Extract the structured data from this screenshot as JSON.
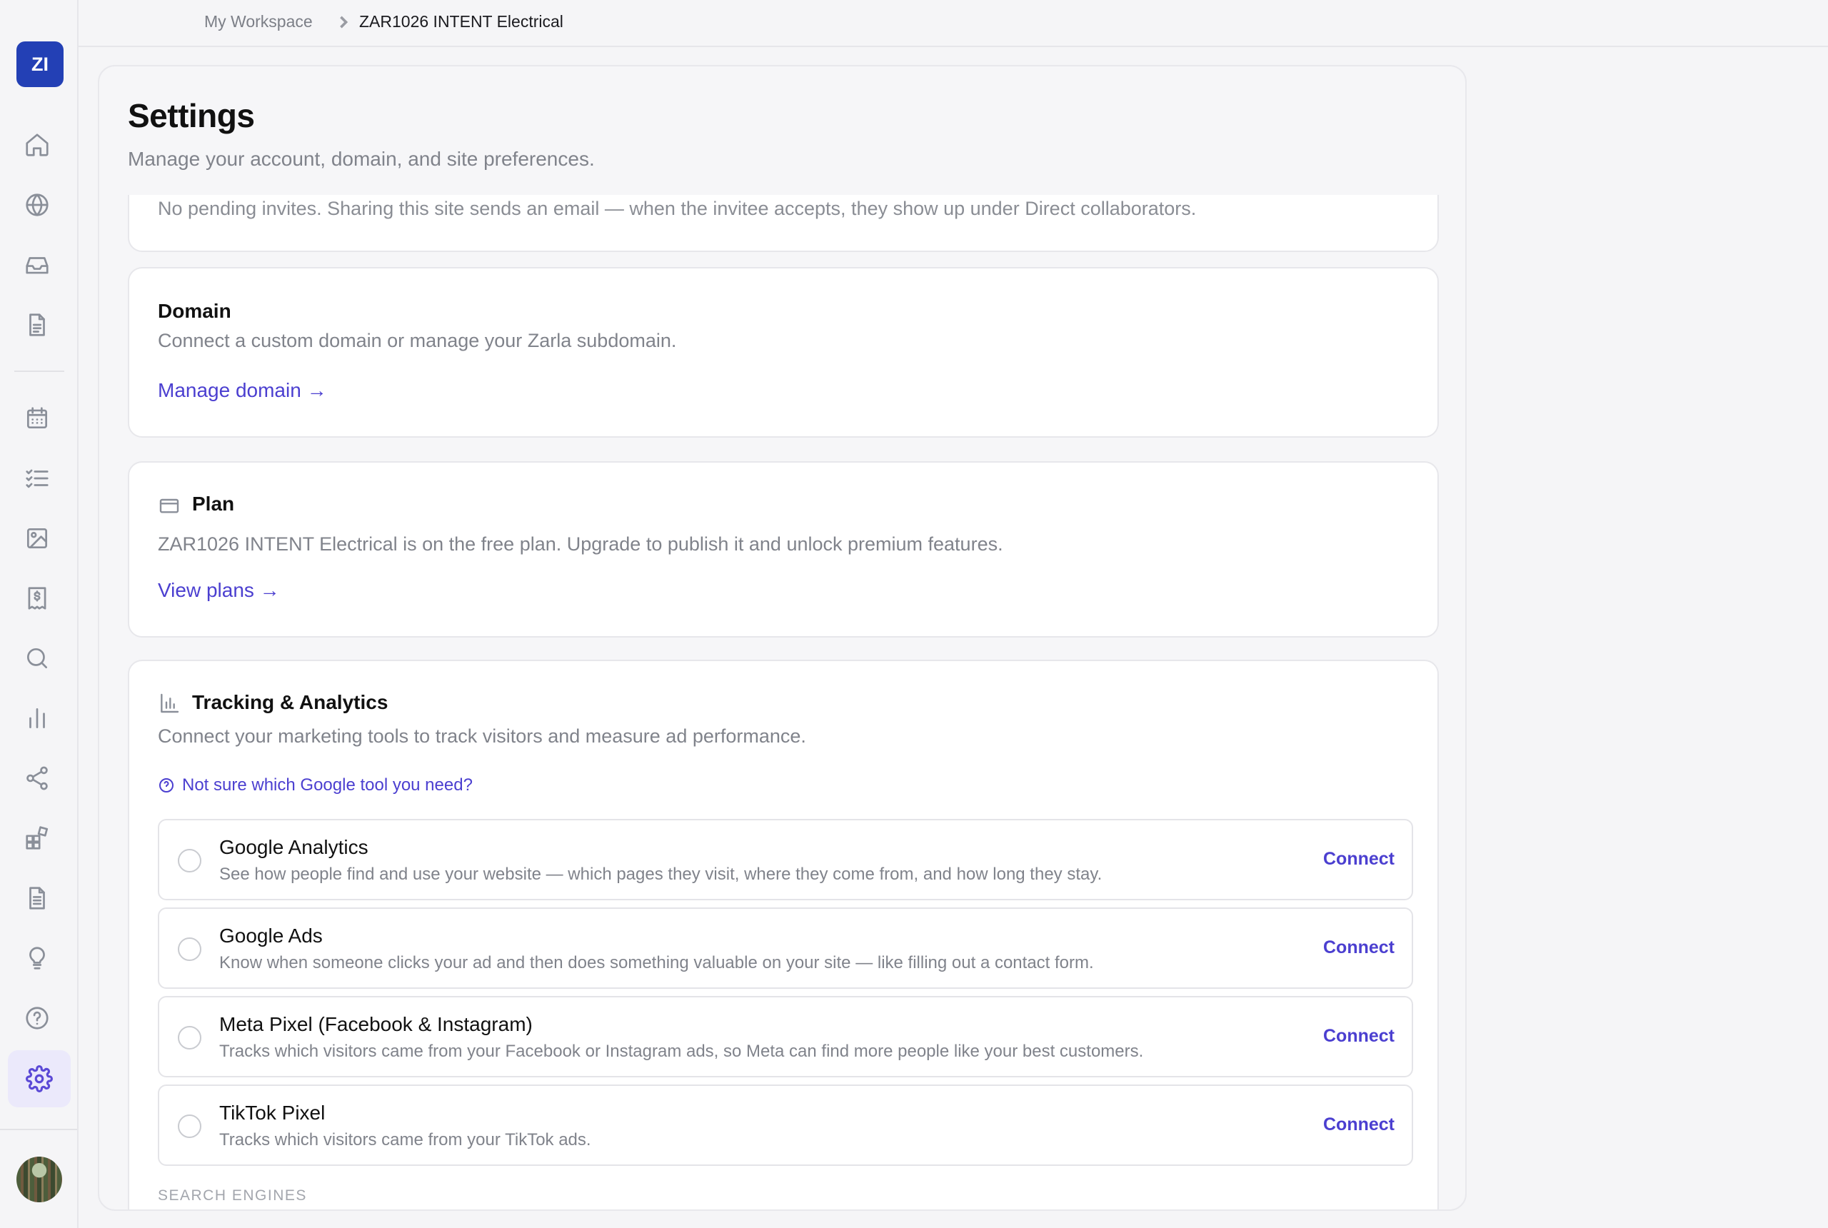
{
  "sidebar": {
    "logo_text": "ZI",
    "items": [
      {
        "name": "home-icon"
      },
      {
        "name": "globe-icon"
      },
      {
        "name": "inbox-icon"
      },
      {
        "name": "document-icon"
      },
      {
        "name": "calendar-icon"
      },
      {
        "name": "checklist-icon"
      },
      {
        "name": "image-icon"
      },
      {
        "name": "invoice-icon"
      },
      {
        "name": "search-icon"
      },
      {
        "name": "bar-chart-icon"
      },
      {
        "name": "share-icon"
      },
      {
        "name": "apps-icon"
      },
      {
        "name": "file-text-icon"
      },
      {
        "name": "lightbulb-icon"
      },
      {
        "name": "help-icon"
      },
      {
        "name": "gear-icon"
      }
    ],
    "active_item": "gear-icon"
  },
  "breadcrumb": {
    "workspace": "My Workspace",
    "site": "ZAR1026 INTENT Electrical"
  },
  "page": {
    "title": "Settings",
    "subtitle": "Manage your account, domain, and site preferences."
  },
  "invites": {
    "text": "No pending invites. Sharing this site sends an email — when the invitee accepts, they show up under Direct collaborators."
  },
  "domain": {
    "title": "Domain",
    "description": "Connect a custom domain or manage your Zarla subdomain.",
    "link": "Manage domain →"
  },
  "plan": {
    "title": "Plan",
    "description": "ZAR1026 INTENT Electrical is on the free plan. Upgrade to publish it and unlock premium features.",
    "link": "View plans →"
  },
  "tracking": {
    "title": "Tracking & Analytics",
    "description": "Connect your marketing tools to track visitors and measure ad performance.",
    "help_link": "Not sure which Google tool you need?",
    "tools": [
      {
        "name": "Google Analytics",
        "description": "See how people find and use your website — which pages they visit, where they come from, and how long they stay.",
        "action": "Connect"
      },
      {
        "name": "Google Ads",
        "description": "Know when someone clicks your ad and then does something valuable on your site — like filling out a contact form.",
        "action": "Connect"
      },
      {
        "name": "Meta Pixel (Facebook & Instagram)",
        "description": "Tracks which visitors came from your Facebook or Instagram ads, so Meta can find more people like your best customers.",
        "action": "Connect"
      },
      {
        "name": "TikTok Pixel",
        "description": "Tracks which visitors came from your TikTok ads.",
        "action": "Connect"
      }
    ],
    "next_section_label": "SEARCH ENGINES"
  },
  "colors": {
    "accent": "#4b3fd0",
    "logo_bg": "#2340b5",
    "active_nav_bg": "#ebe9fb"
  }
}
